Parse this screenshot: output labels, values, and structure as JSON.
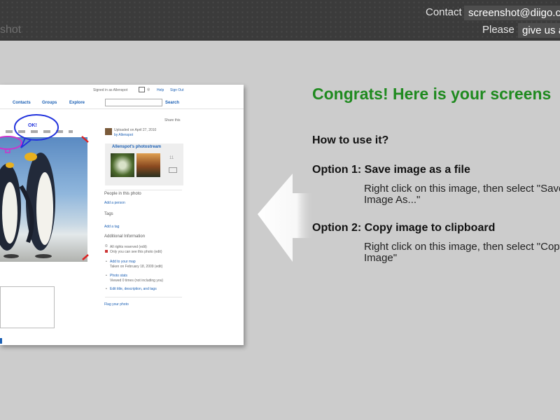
{
  "header": {
    "brand_fragment": "shot",
    "contact_label": "Contact",
    "contact_email": "screenshot@diigo.c",
    "please_label": "Please",
    "feedback_link": "give us a"
  },
  "thumbnail": {
    "signed_in": "Signed in as Allenspot",
    "help": "Help",
    "sign_out": "Sign Out",
    "nav": [
      "Contacts",
      "Groups",
      "Explore"
    ],
    "search_button": "Search",
    "share_this": "Share this",
    "annotation_ok": "OK!",
    "uploaded_on": "Uploaded on April 27, 2010",
    "uploaded_by": "by Allenspot",
    "photostream_title": "Allenspot's photostream",
    "photostream_count": "11",
    "people_heading": "People in this photo",
    "add_person": "Add a person",
    "tags_heading": "Tags",
    "add_tag": "Add a tag",
    "additional_heading": "Additional Information",
    "all_rights": "All rights reserved (edit)",
    "only_you": "Only you can see this photo (edit)",
    "add_to_map": "Add to your map",
    "taken_on": "Taken on February 18, 2009 (edit)",
    "photo_stats": "Photo stats",
    "viewed": "Viewed 0 times (not including you)",
    "edit_title": "Edit title, description, and tags",
    "flag_photo": "Flag your photo"
  },
  "panel": {
    "congrats": "Congrats! Here is your screens",
    "how_to": "How to use it?",
    "option1_title": "Option 1: Save image as a file",
    "option1_desc": "Right click on this image, then select \"Save Image As...\"",
    "option2_title": "Option 2: Copy image to clipboard",
    "option2_desc": "Right click on this image, then select \"Copy Image\""
  }
}
